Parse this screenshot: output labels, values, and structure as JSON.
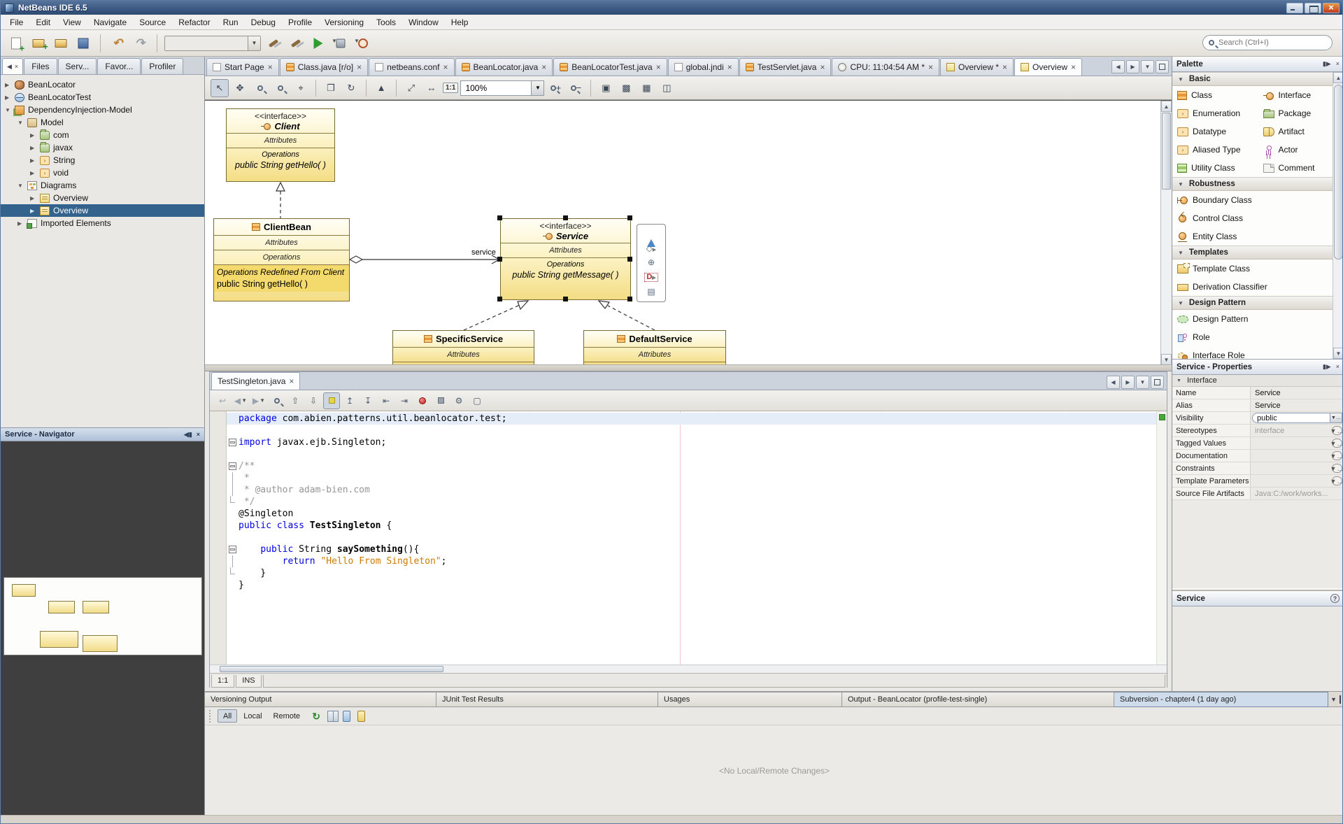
{
  "window": {
    "title": "NetBeans IDE 6.5"
  },
  "menu": [
    "File",
    "Edit",
    "View",
    "Navigate",
    "Source",
    "Refactor",
    "Run",
    "Debug",
    "Profile",
    "Versioning",
    "Tools",
    "Window",
    "Help"
  ],
  "main_toolbar": {
    "search_placeholder": "Search (Ctrl+I)"
  },
  "explorer": {
    "tabs": [
      {
        "label": "Files"
      },
      {
        "label": "Serv..."
      },
      {
        "label": "Favor..."
      },
      {
        "label": "Profiler"
      }
    ],
    "tree": [
      {
        "lvl": "lv0",
        "exp": "▶",
        "icon": "i-bean",
        "label": "BeanLocator"
      },
      {
        "lvl": "lv0",
        "exp": "▶",
        "icon": "i-web",
        "label": "BeanLocatorTest"
      },
      {
        "lvl": "lv0",
        "exp": "▼",
        "icon": "i-prjmodel",
        "label": "DependencyInjection-Model"
      },
      {
        "lvl": "lv1",
        "exp": "▼",
        "icon": "i-model",
        "label": "Model"
      },
      {
        "lvl": "lv2",
        "exp": "▶",
        "icon": "i-folder",
        "label": "com"
      },
      {
        "lvl": "lv2",
        "exp": "▶",
        "icon": "i-folder",
        "label": "javax"
      },
      {
        "lvl": "lv2",
        "exp": "▶",
        "icon": "i-datatype",
        "label": "String"
      },
      {
        "lvl": "lv2",
        "exp": "▶",
        "icon": "i-datatype",
        "label": "void"
      },
      {
        "lvl": "lv1",
        "exp": "▼",
        "icon": "i-diagrams",
        "label": "Diagrams"
      },
      {
        "lvl": "lv2",
        "exp": "▶",
        "icon": "i-diagram",
        "label": "Overview"
      },
      {
        "lvl": "lv2",
        "exp": "▶",
        "icon": "i-diagram",
        "label": "Overview",
        "sel": "selected"
      },
      {
        "lvl": "lv1",
        "exp": "▶",
        "icon": "i-imported",
        "label": "Imported Elements"
      }
    ]
  },
  "navigator": {
    "title": "Service - Navigator"
  },
  "editor": {
    "tabs": [
      {
        "icon": "t-file",
        "label": "Start Page"
      },
      {
        "icon": "t-java",
        "label": "Class.java [r/o]"
      },
      {
        "icon": "t-file",
        "label": "netbeans.conf"
      },
      {
        "icon": "t-java",
        "label": "BeanLocator.java"
      },
      {
        "icon": "t-java",
        "label": "BeanLocatorTest.java"
      },
      {
        "icon": "t-file",
        "label": "global.jndi"
      },
      {
        "icon": "t-java",
        "label": "TestServlet.java"
      },
      {
        "icon": "t-clock",
        "label": "CPU: 11:04:54 AM *"
      },
      {
        "icon": "t-diagram",
        "label": "Overview *"
      },
      {
        "icon": "t-diagram",
        "label": "Overview",
        "sel": "selected"
      }
    ],
    "diagram_toolbar": {
      "zoom_level": "100%",
      "one_to_one": "1:1"
    }
  },
  "uml": {
    "client": {
      "stereotype": "<<interface>>",
      "name": "Client",
      "attributes": "Attributes",
      "operations": "Operations",
      "operation": "public String getHello( )"
    },
    "client_bean": {
      "name": "ClientBean",
      "attributes": "Attributes",
      "operations": "Operations",
      "redefined": "Operations Redefined From Client",
      "operation": "public String  getHello( )"
    },
    "service": {
      "stereotype": "<<interface>>",
      "name": "Service",
      "attributes": "Attributes",
      "operations": "Operations",
      "operation": "public String  getMessage( )"
    },
    "specific": {
      "name": "SpecificService",
      "attributes": "Attributes"
    },
    "default": {
      "name": "DefaultService",
      "attributes": "Attributes"
    },
    "association_label": "service"
  },
  "inner_editor": {
    "tab_label": "TestSingleton.java",
    "status_position": "1:1",
    "status_mode": "INS",
    "code": [
      {
        "hl": 1,
        "seg": [
          {
            "c": "k",
            "t": "package"
          },
          {
            "t": " com.abien.patterns.util.beanlocator.test;"
          }
        ]
      },
      {
        "seg": []
      },
      {
        "g": "m",
        "seg": [
          {
            "c": "k",
            "t": "import"
          },
          {
            "t": " javax.ejb.Singleton;"
          }
        ]
      },
      {
        "seg": []
      },
      {
        "g": "m",
        "seg": [
          {
            "c": "c",
            "t": "/**"
          }
        ]
      },
      {
        "g": "l",
        "seg": [
          {
            "c": "c",
            "t": " *"
          }
        ]
      },
      {
        "g": "l",
        "seg": [
          {
            "c": "c",
            "t": " * @author adam-bien.com"
          }
        ]
      },
      {
        "g": "e",
        "seg": [
          {
            "c": "c",
            "t": " */"
          }
        ]
      },
      {
        "seg": [
          {
            "t": "@Singleton"
          }
        ]
      },
      {
        "seg": [
          {
            "c": "k",
            "t": "public"
          },
          {
            "t": " "
          },
          {
            "c": "k",
            "t": "class"
          },
          {
            "t": " "
          },
          {
            "c": "b",
            "t": "TestSingleton"
          },
          {
            "t": " {"
          }
        ]
      },
      {
        "seg": []
      },
      {
        "g": "m",
        "seg": [
          {
            "t": "    "
          },
          {
            "c": "k",
            "t": "public"
          },
          {
            "t": " String "
          },
          {
            "c": "b",
            "t": "saySomething"
          },
          {
            "t": "(){"
          }
        ]
      },
      {
        "g": "l",
        "seg": [
          {
            "t": "        "
          },
          {
            "c": "k",
            "t": "return"
          },
          {
            "t": " "
          },
          {
            "c": "s",
            "t": "\"Hello From Singleton\""
          },
          {
            "t": ";"
          }
        ]
      },
      {
        "g": "e",
        "seg": [
          {
            "t": "    }"
          }
        ]
      },
      {
        "seg": [
          {
            "t": "}"
          }
        ]
      }
    ]
  },
  "palette": {
    "title": "Palette",
    "sections": {
      "basic": "Basic",
      "robustness": "Robustness",
      "templates": "Templates",
      "design_pattern": "Design Pattern"
    },
    "basic_items": [
      {
        "icon": "pi-class",
        "label": "Class"
      },
      {
        "icon": "pi-interface",
        "label": "Interface"
      },
      {
        "icon": "pi-enum",
        "label": "Enumeration"
      },
      {
        "icon": "pi-package",
        "label": "Package"
      },
      {
        "icon": "pi-datatype",
        "label": "Datatype"
      },
      {
        "icon": "pi-artifact",
        "label": "Artifact"
      },
      {
        "icon": "pi-aliased",
        "label": "Aliased Type"
      },
      {
        "icon": "pi-actor",
        "label": "Actor"
      },
      {
        "icon": "pi-utility",
        "label": "Utility Class"
      },
      {
        "icon": "pi-comment",
        "label": "Comment"
      }
    ],
    "robustness_items": [
      {
        "icon": "pi-boundary",
        "label": "Boundary Class"
      },
      {
        "icon": "pi-control",
        "label": "Control Class"
      },
      {
        "icon": "pi-entity",
        "label": "Entity Class"
      }
    ],
    "templates_items": [
      {
        "icon": "pi-template",
        "label": "Template Class"
      },
      {
        "icon": "pi-derivation",
        "label": "Derivation Classifier"
      }
    ],
    "design_pattern_items": [
      {
        "icon": "pi-pattern",
        "label": "Design Pattern"
      },
      {
        "icon": "pi-role",
        "label": "Role"
      },
      {
        "icon": "pi-ifrole",
        "label": "Interface Role"
      }
    ]
  },
  "properties": {
    "title": "Service - Properties",
    "section": "Interface",
    "rows": [
      {
        "label": "Name",
        "value": "Service",
        "kind": "plain"
      },
      {
        "label": "Alias",
        "value": "Service",
        "kind": "plain"
      },
      {
        "label": "Visibility",
        "value": "public",
        "kind": "combo"
      },
      {
        "label": "Stereotypes",
        "value": "interface",
        "kind": "dots",
        "vcls": "dim"
      },
      {
        "label": "Tagged Values",
        "value": "",
        "kind": "dots"
      },
      {
        "label": "Documentation",
        "value": "",
        "kind": "dots"
      },
      {
        "label": "Constraints",
        "value": "",
        "kind": "dots"
      },
      {
        "label": "Template Parameters",
        "value": "",
        "kind": "dots"
      },
      {
        "label": "Source File Artifacts",
        "value": "Java:C:/work/works...",
        "kind": "plain",
        "vcls": "dim"
      }
    ]
  },
  "service_panel": {
    "title": "Service"
  },
  "bottom": {
    "tabs": [
      {
        "label": "Versioning Output",
        "w": "b0"
      },
      {
        "label": "JUnit Test Results",
        "w": "b1"
      },
      {
        "label": "Usages",
        "w": "b2"
      },
      {
        "label": "Output - BeanLocator (profile-test-single)",
        "w": "b3"
      },
      {
        "label": "Subversion - chapter4 (1 day ago)",
        "w": "b4",
        "sel": "selected"
      }
    ],
    "filters": [
      {
        "label": "All",
        "sel": "pressed"
      },
      {
        "label": "Local"
      },
      {
        "label": "Remote"
      }
    ],
    "empty_message": "<No Local/Remote Changes>"
  }
}
